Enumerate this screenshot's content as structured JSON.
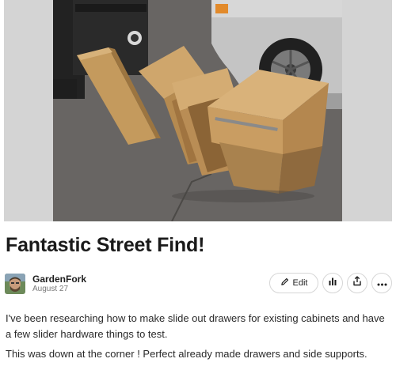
{
  "post": {
    "title": "Fantastic Street Find!",
    "author": "GardenFork",
    "date": "August 27",
    "paragraphs": [
      "I've been researching how to make slide out drawers for existing cabinets and have a few slider hardware things to test.",
      "This was down at the corner ! Perfect already made drawers and side supports."
    ]
  },
  "actions": {
    "edit_label": "Edit",
    "edit_icon": "pencil-icon",
    "stats_icon": "bar-chart-icon",
    "share_icon": "share-icon",
    "more_icon": "more-horizontal-icon"
  },
  "colors": {
    "text": "#1f1f1f",
    "muted": "#777777",
    "button_border": "#d6d6d6"
  }
}
